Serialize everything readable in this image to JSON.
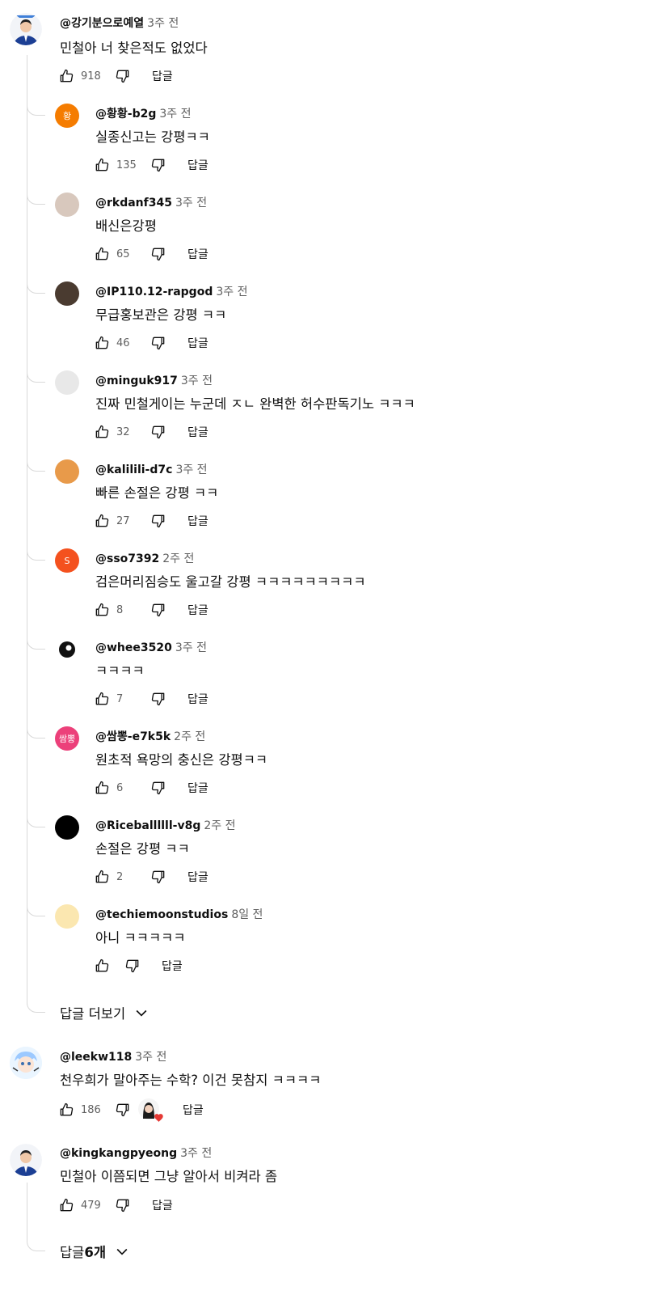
{
  "main_comment": {
    "author": "@강기분으로예열",
    "time": "3주 전",
    "text": "민철아 너 찾은적도 없었다",
    "likes": "918",
    "reply_label": "답글"
  },
  "replies": [
    {
      "author": "@황황-b2g",
      "time": "3주 전",
      "text": "실종신고는 강평ㅋㅋ",
      "likes": "135",
      "reply_label": "답글",
      "avatar_letter": "황",
      "avatar_color": "#f57c00"
    },
    {
      "author": "@rkdanf345",
      "time": "3주 전",
      "text": "배신은강평",
      "likes": "65",
      "reply_label": "답글",
      "avatar_color": "#d8c8bd"
    },
    {
      "author": "@IP110.12-rapgod",
      "time": "3주 전",
      "text": "무급홍보관은 강평 ㅋㅋ",
      "likes": "46",
      "reply_label": "답글",
      "avatar_color": "#4a3b30"
    },
    {
      "author": "@minguk917",
      "time": "3주 전",
      "text": "진짜 민철게이는 누군데 ㅈㄴ 완벽한 허수판독기노 ㅋㅋㅋ",
      "likes": "32",
      "reply_label": "답글",
      "avatar_color": "#e8e8e8"
    },
    {
      "author": "@kalilili-d7c",
      "time": "3주 전",
      "text": "빠른 손절은 강평 ㅋㅋ",
      "likes": "27",
      "reply_label": "답글",
      "avatar_color": "#e89a4a"
    },
    {
      "author": "@sso7392",
      "time": "2주 전",
      "text": "검은머리짐승도 울고갈 강평 ㅋㅋㅋㅋㅋㅋㅋㅋㅋ",
      "likes": "8",
      "reply_label": "답글",
      "avatar_letter": "S",
      "avatar_color": "#f4511e"
    },
    {
      "author": "@whee3520",
      "time": "3주 전",
      "text": "ㅋㅋㅋㅋ",
      "likes": "7",
      "reply_label": "답글",
      "avatar_color": "#ffffff"
    },
    {
      "author": "@쌈뽕-e7k5k",
      "time": "2주 전",
      "text": "원초적 욕망의 충신은 강평ㅋㅋ",
      "likes": "6",
      "reply_label": "답글",
      "avatar_letter": "쌈뽕",
      "avatar_color": "#ec407a"
    },
    {
      "author": "@Riceballllll-v8g",
      "time": "2주 전",
      "text": "손절은 강평 ㅋㅋ",
      "likes": "2",
      "reply_label": "답글",
      "avatar_color": "#000000"
    },
    {
      "author": "@techiemoonstudios",
      "time": "8일 전",
      "text": "아니 ㅋㅋㅋㅋㅋ",
      "likes": "",
      "reply_label": "답글",
      "avatar_color": "#fbe7b0"
    }
  ],
  "show_more_replies": "답글 더보기",
  "comment2": {
    "author": "@leekw118",
    "time": "3주 전",
    "text": "천우희가 말아주는 수학? 이건 못참지 ㅋㅋㅋㅋ",
    "likes": "186",
    "reply_label": "답글"
  },
  "comment3": {
    "author": "@kingkangpyeong",
    "time": "3주 전",
    "text": "민철아 이쯤되면 그냥 알아서 비켜라 좀",
    "likes": "479",
    "reply_label": "답글",
    "replies_count_label": "답글 ",
    "replies_count": "6개"
  },
  "colors": {
    "text": "#0f0f0f",
    "secondary": "#606060",
    "thread_line": "#d9d9d9",
    "heart": "#e53935"
  }
}
